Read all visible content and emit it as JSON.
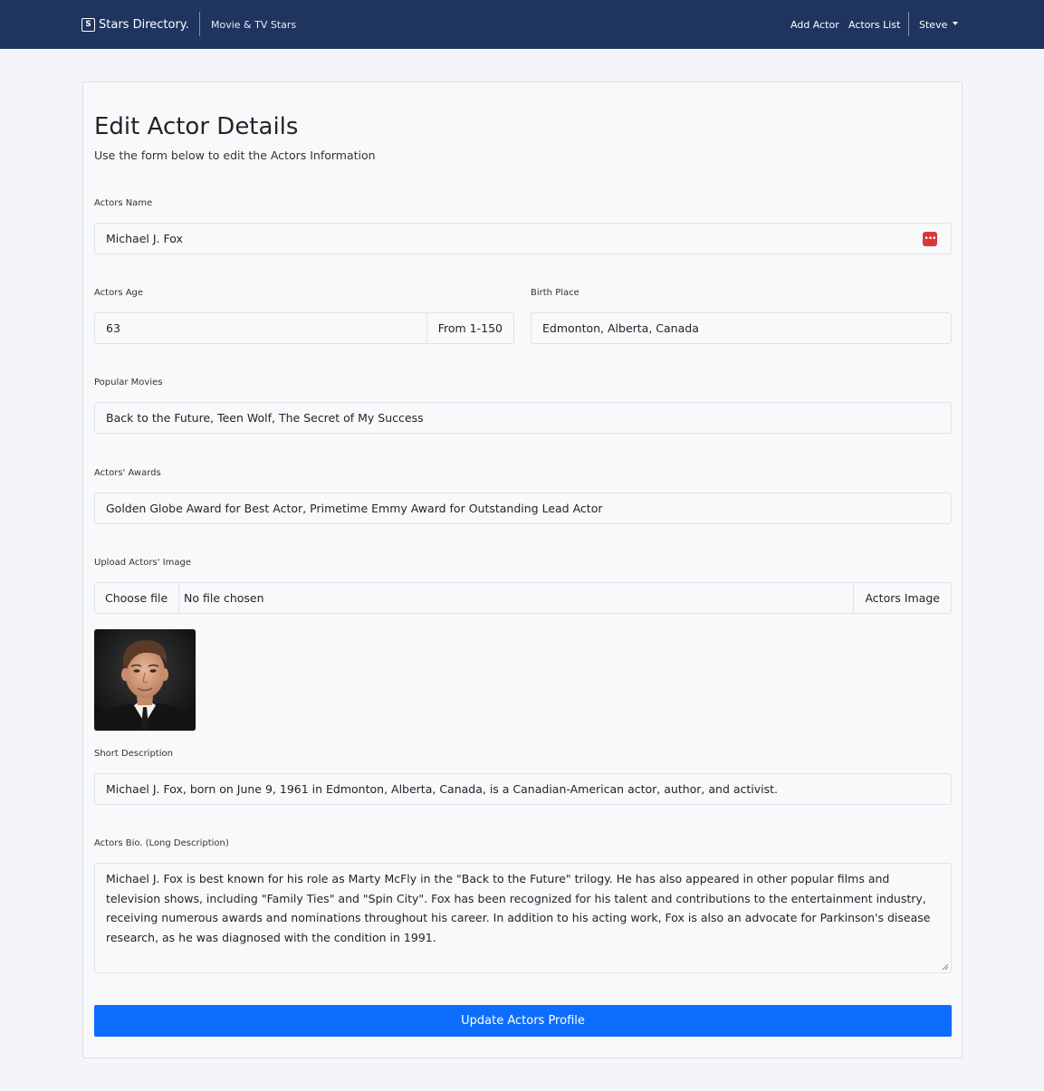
{
  "navbar": {
    "brand_logo": "S",
    "brand_name": "Stars Directory.",
    "subtitle": "Movie & TV Stars",
    "links": {
      "add_actor": "Add Actor",
      "actors_list": "Actors List",
      "user": "Steve"
    },
    "background_color": "#1f3560"
  },
  "form": {
    "title": "Edit Actor Details",
    "subtitle": "Use the form below to edit the Actors Information",
    "name": {
      "label": "Actors Name",
      "value": "Michael J. Fox",
      "icon": "password-manager-icon"
    },
    "age": {
      "label": "Actors Age",
      "value": "63",
      "addon": "From 1-150"
    },
    "birth_place": {
      "label": "Birth Place",
      "value": "Edmonton, Alberta, Canada"
    },
    "movies": {
      "label": "Popular Movies",
      "value": "Back to the Future, Teen Wolf, The Secret of My Success"
    },
    "awards": {
      "label": "Actors' Awards",
      "value": "Golden Globe Award for Best Actor, Primetime Emmy Award for Outstanding Lead Actor"
    },
    "image": {
      "label": "Upload Actors' Image",
      "button": "Choose file",
      "status": "No file chosen",
      "addon": "Actors Image"
    },
    "short_description": {
      "label": "Short Description",
      "value": "Michael J. Fox, born on June 9, 1961 in Edmonton, Alberta, Canada, is a Canadian-American actor, author, and activist."
    },
    "bio": {
      "label": "Actors Bio. (Long Description)",
      "value": "Michael J. Fox is best known for his role as Marty McFly in the \"Back to the Future\" trilogy. He has also appeared in other popular films and television shows, including \"Family Ties\" and \"Spin City\". Fox has been recognized for his talent and contributions to the entertainment industry, receiving numerous awards and nominations throughout his career. In addition to his acting work, Fox is also an advocate for Parkinson's disease research, as he was diagnosed with the condition in 1991."
    },
    "submit": "Update Actors Profile",
    "accent_color": "#0d6efd"
  }
}
